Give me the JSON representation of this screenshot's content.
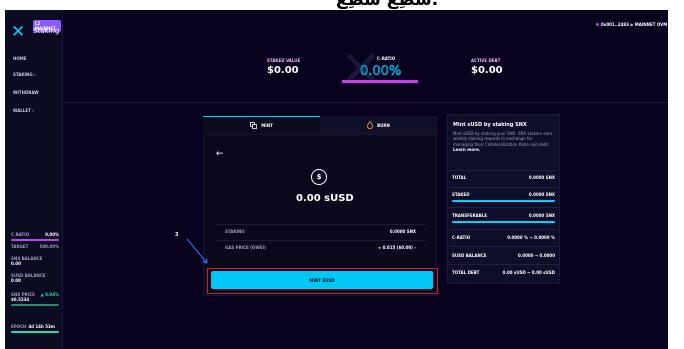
{
  "top_strip_text": "سْطِعْ سْطِعْ.",
  "app": {
    "logo_mark": "✕",
    "logo_badge": "L2 MAINNET",
    "logo_text": "Staking"
  },
  "nav": [
    "HOME",
    "STAKING ›",
    "WITHDRAW",
    "WALLET ›"
  ],
  "header": {
    "wallet": "0x001..2483 ◈ MAINNET OVM",
    "gear_icon": "⚙"
  },
  "stats": {
    "staked_label": "STAKED VALUE",
    "staked_value": "$0.00",
    "cratio_label": "C-RATIO",
    "cratio_value": "0.00%",
    "debt_label": "ACTIVE DEBT",
    "debt_value": "$0.00"
  },
  "sidebar_stats": {
    "cratio_label": "C-RATIO",
    "cratio_value": "0.00%",
    "target_label": "TARGET",
    "target_value": "500.00%",
    "snx_balance_label": "SNX BALANCE",
    "snx_balance_value": "0.00",
    "susd_balance_label": "sUSD BALANCE",
    "susd_balance_value": "0.00",
    "snx_price_label": "SNX PRICE",
    "snx_price_change": "▲ 0.94%",
    "snx_price_value": "$0.5234",
    "epoch_label": "EPOCH",
    "epoch_value": "4d 14h 53m"
  },
  "tabs": {
    "mint_label": "MINT",
    "burn_label": "BURN"
  },
  "mint": {
    "back_icon": "←",
    "coin_symbol": "$",
    "amount": "0.00 sUSD",
    "staking_label": "STAKING",
    "staking_value": "0.0000 SNX",
    "gas_label": "GAS PRICE (GWEI)",
    "gas_value": "≈ 0.015 ($0.00) ›",
    "button_label": "MINT sUSD"
  },
  "annotation": {
    "number": "3"
  },
  "info": {
    "title": "Mint sUSD by staking SNX",
    "desc": "Mint sUSD by staking your SNX. SNX stakers earn weekly staking rewards in exchange for managing their Collateralization Ratio and debt.",
    "learn_more": "Learn more.",
    "rows": [
      {
        "k": "TOTAL",
        "v": "0.0000 SNX"
      },
      {
        "k": "STAKED",
        "v": "0.0000 SNX"
      },
      {
        "k": "TRANSFERABLE",
        "v": "0.0000 SNX"
      },
      {
        "k": "C-RATIO",
        "v": "0.0000 % → 0.0000 %"
      },
      {
        "k": "sUSD BALANCE",
        "v": "0.0000 → 0.0000"
      },
      {
        "k": "TOTAL DEBT",
        "v": "0.00 sUSD → 0.00 sUSD"
      }
    ]
  }
}
